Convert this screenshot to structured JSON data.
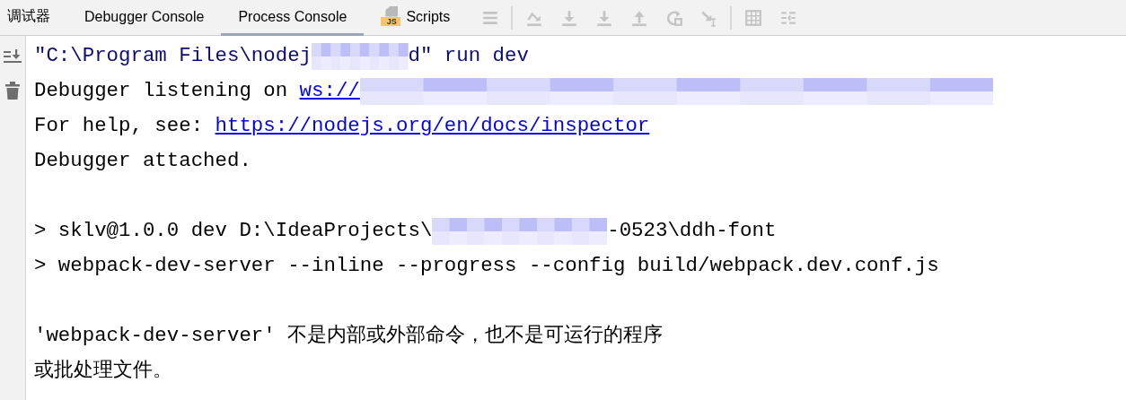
{
  "tabs": [
    {
      "label": "调试器",
      "selected": false,
      "kind": "plain"
    },
    {
      "label": "Debugger Console",
      "selected": false,
      "kind": "plain"
    },
    {
      "label": "Process Console",
      "selected": true,
      "kind": "plain"
    },
    {
      "label": "Scripts",
      "selected": false,
      "kind": "scripts",
      "icon_text": "JS"
    }
  ],
  "toolbar": [
    {
      "kind": "menu",
      "disabled": true
    },
    {
      "kind": "separator"
    },
    {
      "kind": "step-over",
      "disabled": true
    },
    {
      "kind": "step-into",
      "disabled": true
    },
    {
      "kind": "force-step-into",
      "disabled": true
    },
    {
      "kind": "step-out",
      "disabled": true
    },
    {
      "kind": "drop-frame",
      "disabled": true
    },
    {
      "kind": "run-to-cursor",
      "disabled": true
    },
    {
      "kind": "separator"
    },
    {
      "kind": "evaluate",
      "disabled": true
    },
    {
      "kind": "trace",
      "disabled": true
    }
  ],
  "console": {
    "lines": [
      {
        "kind": "command",
        "segments": [
          {
            "kind": "text",
            "text": "\"C:\\Program Files\\nodej"
          },
          {
            "kind": "mask-short"
          },
          {
            "kind": "text",
            "text": "d\" run dev"
          }
        ]
      },
      {
        "kind": "output",
        "segments": [
          {
            "kind": "text",
            "text": "Debugger listening on "
          },
          {
            "kind": "link",
            "text": "ws://"
          },
          {
            "kind": "mask-long"
          }
        ]
      },
      {
        "kind": "output",
        "segments": [
          {
            "kind": "text",
            "text": "For help, see: "
          },
          {
            "kind": "link",
            "text": "https://nodejs.org/en/docs/inspector"
          }
        ]
      },
      {
        "kind": "output",
        "segments": [
          {
            "kind": "text",
            "text": "Debugger attached."
          }
        ]
      },
      {
        "kind": "blank"
      },
      {
        "kind": "output",
        "segments": [
          {
            "kind": "text",
            "text": "> sklv@1.0.0 dev D:\\IdeaProjects\\"
          },
          {
            "kind": "mask-medium"
          },
          {
            "kind": "text",
            "text": "-0523\\ddh-font"
          }
        ]
      },
      {
        "kind": "output",
        "segments": [
          {
            "kind": "text",
            "text": "> webpack-dev-server --inline --progress --config build/webpack.dev.conf.js"
          }
        ]
      },
      {
        "kind": "blank"
      },
      {
        "kind": "output",
        "segments": [
          {
            "kind": "text",
            "text": "'webpack-dev-server' 不是内部或外部命令，也不是可运行的程序"
          }
        ]
      },
      {
        "kind": "output",
        "segments": [
          {
            "kind": "text",
            "text": "或批处理文件。"
          }
        ]
      }
    ]
  }
}
